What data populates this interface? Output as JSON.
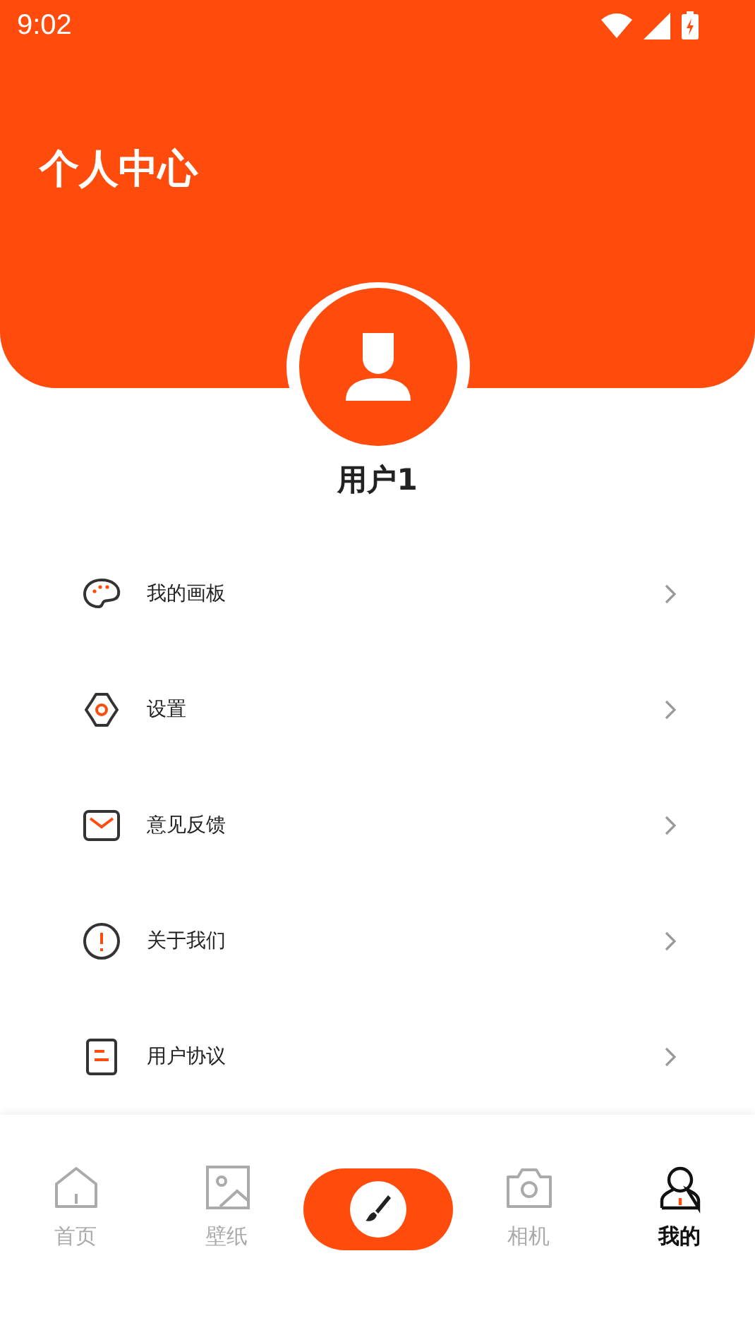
{
  "status_bar": {
    "time": "9:02"
  },
  "header": {
    "title": "个人中心"
  },
  "profile": {
    "username": "用户1"
  },
  "menu": [
    {
      "label": "我的画板",
      "kind": "palette"
    },
    {
      "label": "设置",
      "kind": "gear"
    },
    {
      "label": "意见反馈",
      "kind": "mail"
    },
    {
      "label": "关于我们",
      "kind": "info"
    },
    {
      "label": "用户协议",
      "kind": "document"
    }
  ],
  "bottom_nav": [
    {
      "label": "首页",
      "kind": "home",
      "selected": false
    },
    {
      "label": "壁纸",
      "kind": "image",
      "selected": false
    },
    {
      "kind": "brush",
      "selected": false
    },
    {
      "label": "相机",
      "kind": "camera",
      "selected": false
    },
    {
      "label": "我的",
      "kind": "person",
      "selected": true
    }
  ]
}
